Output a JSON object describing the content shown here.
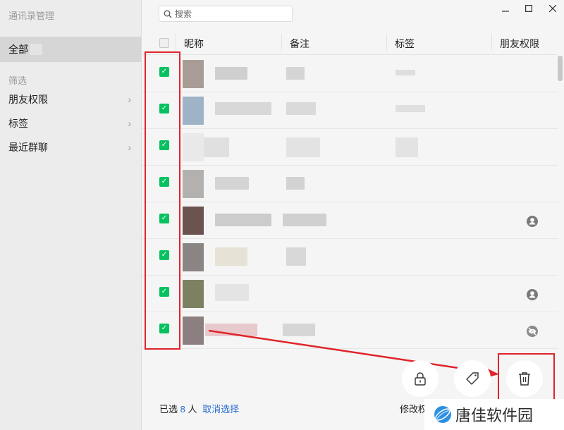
{
  "sidebar": {
    "title": "通讯录管理",
    "all": "全部",
    "filter_title": "筛选",
    "items": [
      {
        "label": "朋友权限"
      },
      {
        "label": "标签"
      },
      {
        "label": "最近群聊"
      }
    ]
  },
  "search": {
    "placeholder": "搜索"
  },
  "window_controls": [
    "minimize",
    "maximize",
    "close"
  ],
  "table": {
    "columns": [
      "昵称",
      "备注",
      "标签",
      "朋友权限"
    ],
    "rows": [
      {
        "checked": true,
        "permission_icon": ""
      },
      {
        "checked": true,
        "permission_icon": ""
      },
      {
        "checked": true,
        "permission_icon": ""
      },
      {
        "checked": true,
        "permission_icon": ""
      },
      {
        "checked": true,
        "permission_icon": "person-icon"
      },
      {
        "checked": true,
        "permission_icon": ""
      },
      {
        "checked": true,
        "permission_icon": "person-icon"
      },
      {
        "checked": true,
        "permission_icon": "eye-hidden-icon"
      }
    ]
  },
  "footer": {
    "selected_prefix": "已选",
    "selected_count": "8",
    "selected_suffix": "人",
    "cancel_label": "取消选择",
    "modify_label": "修改权"
  },
  "watermark": {
    "text": "唐佳软件园"
  },
  "colors": {
    "accent_green": "#07c160",
    "annotation_red": "#e0242a",
    "link_blue": "#2a6fd1"
  }
}
